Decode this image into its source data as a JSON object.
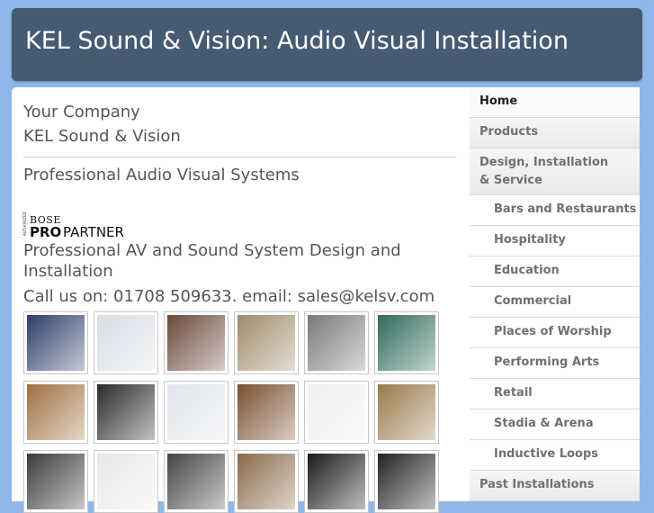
{
  "header": {
    "title": "KEL Sound & Vision: Audio Visual Installation"
  },
  "main": {
    "company_line1": "Your Company",
    "company_line2": "KEL Sound & Vision",
    "tagline": "Professional Audio Visual Systems",
    "logo": {
      "small_text": "AUTHORIZED",
      "brand": "BOSE",
      "pro": "PRO",
      "partner": "PARTNER"
    },
    "description": "Professional AV and Sound System Design and Installation",
    "contact": "Call us on: 01708 509633. email: sales@kelsv.com",
    "gallery": [
      {
        "name": "bar-interior-photo",
        "color": "#2c3e6a"
      },
      {
        "name": "wall-control-panel-photo",
        "color": "#d7dde6"
      },
      {
        "name": "restaurant-photo",
        "color": "#6a4a3a"
      },
      {
        "name": "column-speaker-photo",
        "color": "#a08a6a"
      },
      {
        "name": "rack-room-photo",
        "color": "#7a7a7a"
      },
      {
        "name": "auditorium-photo",
        "color": "#2f6a5a"
      },
      {
        "name": "church-interior-photo",
        "color": "#a07040"
      },
      {
        "name": "speaker-photo",
        "color": "#2a2a2a"
      },
      {
        "name": "volume-controller-photo",
        "color": "#e0e4ea"
      },
      {
        "name": "event-hall-photo",
        "color": "#7a5030"
      },
      {
        "name": "wall-plate-photo",
        "color": "#eeeeee"
      },
      {
        "name": "lounge-photo",
        "color": "#9a7a4a"
      },
      {
        "name": "amplifier-photo",
        "color": "#3a3a3a"
      },
      {
        "name": "loudspeaker-grille-photo",
        "color": "#e8e8e8"
      },
      {
        "name": "rack-unit-photo",
        "color": "#444444"
      },
      {
        "name": "cathedral-photo",
        "color": "#8a6a4a"
      },
      {
        "name": "line-array-photo",
        "color": "#1a1a1a"
      },
      {
        "name": "column-array-photo",
        "color": "#222222"
      }
    ]
  },
  "sidebar": {
    "items": [
      {
        "label": "Home",
        "level": 0,
        "active": true
      },
      {
        "label": "Products",
        "level": 0
      },
      {
        "label": "Design, Installation & Service",
        "level": 0
      },
      {
        "label": "Bars and Restaurants",
        "level": 1
      },
      {
        "label": "Hospitality",
        "level": 1
      },
      {
        "label": "Education",
        "level": 1
      },
      {
        "label": "Commercial",
        "level": 1
      },
      {
        "label": "Places of Worship",
        "level": 1
      },
      {
        "label": "Performing Arts",
        "level": 1
      },
      {
        "label": "Retail",
        "level": 1
      },
      {
        "label": "Stadia & Arena",
        "level": 1
      },
      {
        "label": "Inductive Loops",
        "level": 1
      },
      {
        "label": "Past Installations",
        "level": 0
      }
    ]
  }
}
